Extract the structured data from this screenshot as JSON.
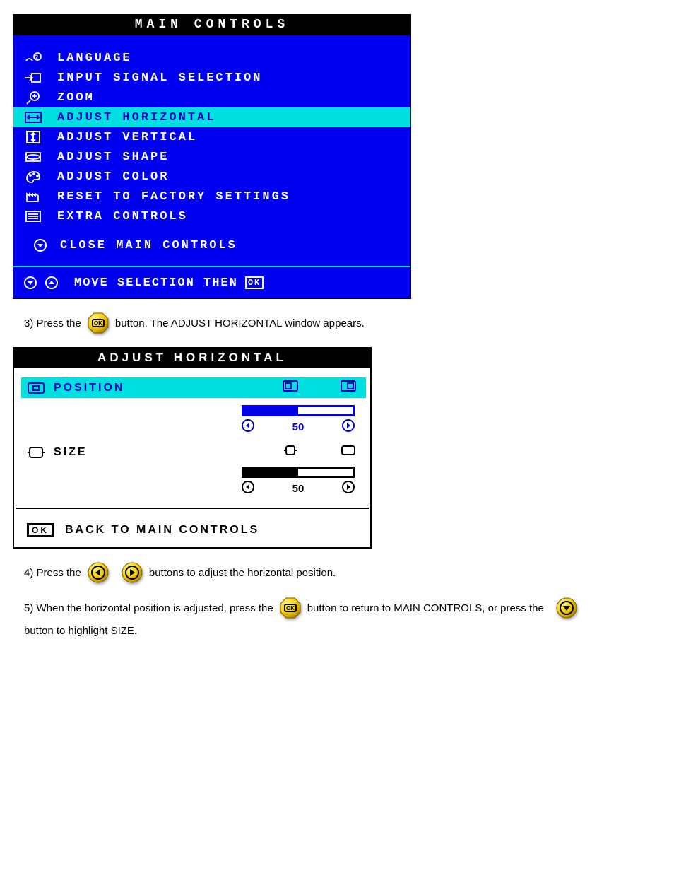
{
  "main_controls": {
    "title": "MAIN CONTROLS",
    "items": [
      {
        "label": "LANGUAGE",
        "icon": "language",
        "selected": false
      },
      {
        "label": "INPUT SIGNAL SELECTION",
        "icon": "input",
        "selected": false
      },
      {
        "label": "ZOOM",
        "icon": "zoom",
        "selected": false
      },
      {
        "label": "ADJUST HORIZONTAL",
        "icon": "horiz",
        "selected": true
      },
      {
        "label": "ADJUST VERTICAL",
        "icon": "vert",
        "selected": false
      },
      {
        "label": "ADJUST SHAPE",
        "icon": "shape",
        "selected": false
      },
      {
        "label": "ADJUST COLOR",
        "icon": "color",
        "selected": false
      },
      {
        "label": "RESET TO FACTORY SETTINGS",
        "icon": "factory",
        "selected": false
      },
      {
        "label": "EXTRA CONTROLS",
        "icon": "extra",
        "selected": false
      }
    ],
    "close_label": "CLOSE MAIN CONTROLS",
    "footer_label": "MOVE SELECTION THEN",
    "footer_ok": "OK"
  },
  "steps": {
    "s3_prefix": "3) Press the ",
    "s3_suffix": " button. The ADJUST HORIZONTAL window appears.",
    "s4_prefix": "4) Press the ",
    "s4_mid": " ",
    "s4_suffix": " buttons to adjust the horizontal position.",
    "s5_prefix": "5) When the horizontal position is adjusted, press the ",
    "s5_mid": " button to return to MAIN CONTROLS, or press the ",
    "s5_suffix": " button to highlight SIZE."
  },
  "adjust_horizontal": {
    "title": "ADJUST HORIZONTAL",
    "rows": [
      {
        "name": "position",
        "label": "POSITION",
        "value": 50,
        "selected": true
      },
      {
        "name": "size",
        "label": "SIZE",
        "value": 50,
        "selected": false
      }
    ],
    "back_label": "BACK TO MAIN CONTROLS",
    "back_ok": "OK"
  }
}
